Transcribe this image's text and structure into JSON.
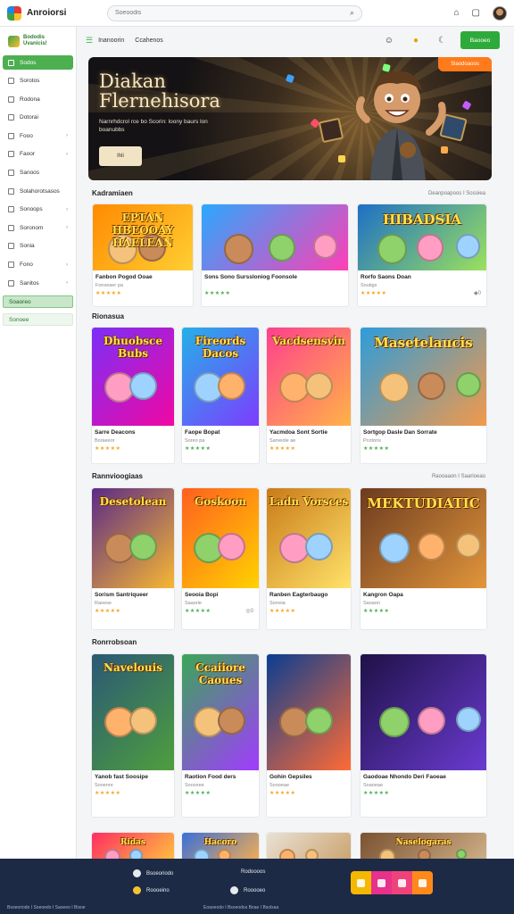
{
  "app": {
    "name": "Anroiorsi"
  },
  "search": {
    "placeholder": "Soeoodis"
  },
  "sidebar": {
    "brand_line1": "Bododis",
    "brand_line2": "Uvanicis!",
    "items": [
      {
        "label": "Sodos",
        "active": true
      },
      {
        "label": "Sorotos",
        "active": false
      },
      {
        "label": "Rodona",
        "active": false
      },
      {
        "label": "Dotorai",
        "active": false
      },
      {
        "label": "Fooo",
        "active": false,
        "chevron": true
      },
      {
        "label": "Faoor",
        "active": false,
        "chevron": true
      },
      {
        "label": "Sanoos",
        "active": false
      },
      {
        "label": "Solahorotsasos",
        "active": false
      },
      {
        "label": "Sonoops",
        "active": false,
        "chevron": true
      },
      {
        "label": "Soronom",
        "active": false,
        "chevron": true
      },
      {
        "label": "Sonia",
        "active": false
      },
      {
        "label": "Fono",
        "active": false,
        "chevron": true
      },
      {
        "label": "Sanitos",
        "active": false,
        "chevron": true
      }
    ],
    "green_items": [
      "Soaoreo",
      "Sonoee"
    ]
  },
  "subheader": {
    "crumb1": "Inanoorin",
    "crumb2": "Ccahenos",
    "action_label": "Baooeo"
  },
  "hero": {
    "title_line1": "Diakan",
    "title_line2": "Flernehisora",
    "subtitle": "Narnrhdcrol rce bo Scorin: loony baurs lon boanubbs",
    "button_label": "Ihli",
    "badge": "Slaodoaoos"
  },
  "sections": [
    {
      "title": "Kadramiaen",
      "link": "Deanpoapoos I Sosoiea"
    },
    {
      "title": "Rionasua",
      "link": ""
    },
    {
      "title": "Rannvioogiaas",
      "link": "Raooaaon I Saarioeao"
    },
    {
      "title": "Ronrrobsoan",
      "link": ""
    }
  ],
  "cards": {
    "row1": [
      {
        "thumb": "EPTAN HBEOOAY HAELEAN",
        "name": "Fanbon Pogod Ooae",
        "meta": "Fonseaer pa",
        "stars": "★★★★★",
        "extra": ""
      },
      {
        "thumb": "",
        "name": "Sons Sono Surssloniog Foonsole",
        "meta": "",
        "stars": "★★★★★",
        "extra": ""
      },
      {
        "thumb": "HIBADSIA",
        "name": "Rorfo Saons Doan",
        "meta": "Soutigs",
        "stars": "★★★★★",
        "extra": "◆0"
      }
    ],
    "row2": [
      {
        "thumb": "Dhuobsce Bubs",
        "name": "Sarre Deacons",
        "meta": "Boraeeor",
        "stars": "★★★★★",
        "extra": ""
      },
      {
        "thumb": "Fireords Dacos",
        "name": "Faope Bopat",
        "meta": "Soreo pa",
        "stars": "★★★★★",
        "extra": ""
      },
      {
        "thumb": "Vacdsensvin",
        "name": "Yacmdoa Sont Sortie",
        "meta": "Sarveole ae",
        "stars": "★★★★★",
        "extra": ""
      },
      {
        "thumb": "Masetelaucis",
        "name": "Sortgop Dasle Dan Sorrate",
        "meta": "Pcotons",
        "stars": "★★★★★",
        "extra": ""
      }
    ],
    "row3": [
      {
        "thumb": "Desetolean",
        "name": "Sorism Santriqueer",
        "meta": "Raoese",
        "stars": "★★★★★",
        "extra": ""
      },
      {
        "thumb": "Goskoon",
        "name": "Seooia Bopi",
        "meta": "Saaorie",
        "stars": "★★★★★",
        "extra": "◎0"
      },
      {
        "thumb": "Ladn Vorsces",
        "name": "Ranben Eagterbaugo",
        "meta": "Sorreia",
        "stars": "★★★★★",
        "extra": ""
      },
      {
        "thumb": "MEKTUDIATIC",
        "name": "Kangron Oapa",
        "meta": "Saoaon",
        "stars": "★★★★★",
        "extra": ""
      }
    ],
    "row4": [
      {
        "thumb": "Navelouis",
        "name": "Yanob fast Soosipe",
        "meta": "Sooenre",
        "stars": "★★★★★",
        "extra": ""
      },
      {
        "thumb": "Ccaiiore Caoues",
        "name": "Raotion Food ders",
        "meta": "Soooxee",
        "stars": "★★★★★",
        "extra": ""
      },
      {
        "thumb": "",
        "name": "Gohin Gepsiles",
        "meta": "Soooeae",
        "stars": "★★★★★",
        "extra": ""
      },
      {
        "thumb": "",
        "name": "Gaodoae Nhondo Deri Faoeae",
        "meta": "Soaoeae",
        "stars": "★★★★★",
        "extra": ""
      }
    ],
    "row5": [
      {
        "thumb": "Ridas"
      },
      {
        "thumb": "Hacoro"
      },
      {
        "thumb": ""
      },
      {
        "thumb": "Naselogaras"
      }
    ]
  },
  "footer": {
    "links": [
      "Bsoeoriodo",
      "Rodoooos",
      "Roooeino",
      "Rooooeo"
    ],
    "bottom_left": "Bsoeoriodo I Soeoedo I Saoeeo I Bisoe",
    "bottom_right": "Eoaoeodo I Bsoeodos Boae I Bsolxaa"
  },
  "colors": {
    "accent": "#2eaa3a",
    "hero_badge": "#ff7a1a",
    "footer_bg": "#1d2a45"
  }
}
